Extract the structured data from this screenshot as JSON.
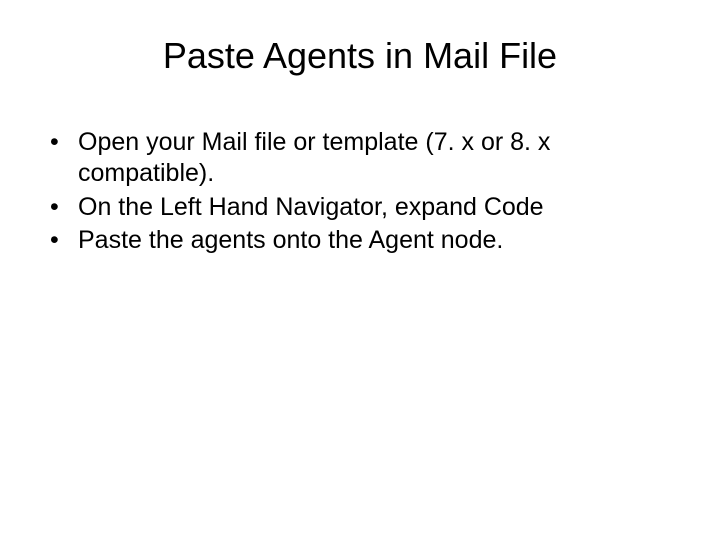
{
  "slide": {
    "title": "Paste Agents in Mail File",
    "bullets": [
      "Open your Mail file or template (7. x or 8. x compatible).",
      "On the Left Hand Navigator, expand Code",
      "Paste the agents onto the Agent node."
    ]
  }
}
